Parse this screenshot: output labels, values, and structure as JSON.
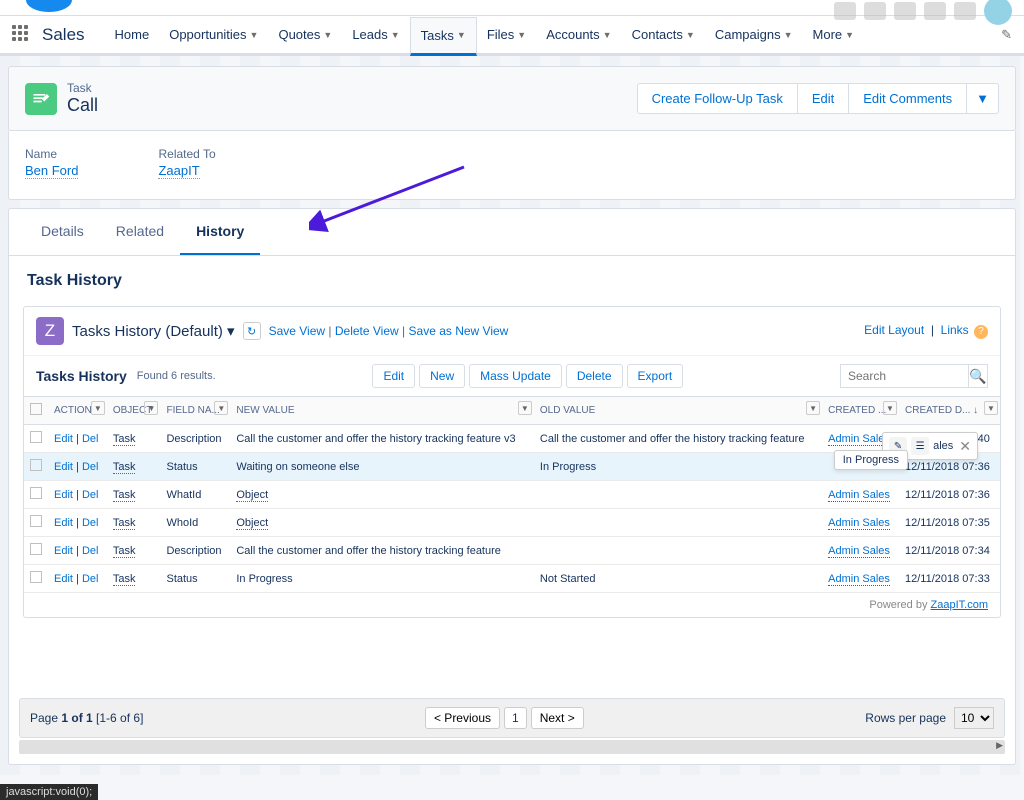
{
  "app_name": "Sales",
  "nav": [
    "Home",
    "Opportunities",
    "Quotes",
    "Leads",
    "Tasks",
    "Files",
    "Accounts",
    "Contacts",
    "Campaigns",
    "More"
  ],
  "nav_active": 4,
  "object": {
    "label": "Task",
    "title": "Call"
  },
  "header_actions": [
    "Create Follow-Up Task",
    "Edit",
    "Edit Comments"
  ],
  "fields": {
    "name_label": "Name",
    "name_value": "Ben Ford",
    "related_label": "Related To",
    "related_value": "ZaapIT"
  },
  "tabs": [
    "Details",
    "Related",
    "History"
  ],
  "section_title": "Task History",
  "view": {
    "name": "Tasks History (Default)",
    "save": "Save View",
    "delete": "Delete View",
    "saveas": "Save as New View",
    "edit_layout": "Edit Layout",
    "links": "Links"
  },
  "toolbar": {
    "title": "Tasks History",
    "results": "Found 6 results.",
    "buttons": [
      "Edit",
      "New",
      "Mass Update",
      "Delete",
      "Export"
    ],
    "search_ph": "Search"
  },
  "columns": [
    "ACTION",
    "OBJECT",
    "FIELD NA...",
    "NEW VALUE",
    "OLD VALUE",
    "CREATED ...",
    "CREATED D..."
  ],
  "rows": [
    {
      "action_edit": "Edit",
      "action_del": "Del",
      "object": "Task",
      "field": "Description",
      "new": "Call the customer and offer the history tracking feature v3",
      "old": "Call the customer and offer the history tracking feature",
      "by": "Admin Sales",
      "date": "12/11/2018 07:40"
    },
    {
      "action_edit": "Edit",
      "action_del": "Del",
      "object": "Task",
      "field": "Status",
      "new": "Waiting on someone else",
      "old": "In Progress",
      "by": "",
      "date": "12/11/2018 07:36"
    },
    {
      "action_edit": "Edit",
      "action_del": "Del",
      "object": "Task",
      "field": "WhatId",
      "new": "Object",
      "old": "",
      "by": "Admin Sales",
      "date": "12/11/2018 07:36",
      "link_new": true
    },
    {
      "action_edit": "Edit",
      "action_del": "Del",
      "object": "Task",
      "field": "WhoId",
      "new": "Object",
      "old": "",
      "by": "Admin Sales",
      "date": "12/11/2018 07:35",
      "link_new": true
    },
    {
      "action_edit": "Edit",
      "action_del": "Del",
      "object": "Task",
      "field": "Description",
      "new": "Call the customer and offer the history tracking feature",
      "old": "",
      "by": "Admin Sales",
      "date": "12/11/2018 07:34"
    },
    {
      "action_edit": "Edit",
      "action_del": "Del",
      "object": "Task",
      "field": "Status",
      "new": "In Progress",
      "old": "Not Started",
      "by": "Admin Sales",
      "date": "12/11/2018 07:33"
    }
  ],
  "hover_tip": "In Progress",
  "powered_label": "Powered by ",
  "powered_link": "ZaapIT.com",
  "pager": {
    "page_text": "Page ",
    "page_bold": "1 of 1",
    "range": "  [1-6 of 6]",
    "prev": "< Previous",
    "page_num": "1",
    "next": "Next >",
    "rpp_label": "Rows per page",
    "rpp_value": "10"
  },
  "status_corner": "javascript:void(0);"
}
